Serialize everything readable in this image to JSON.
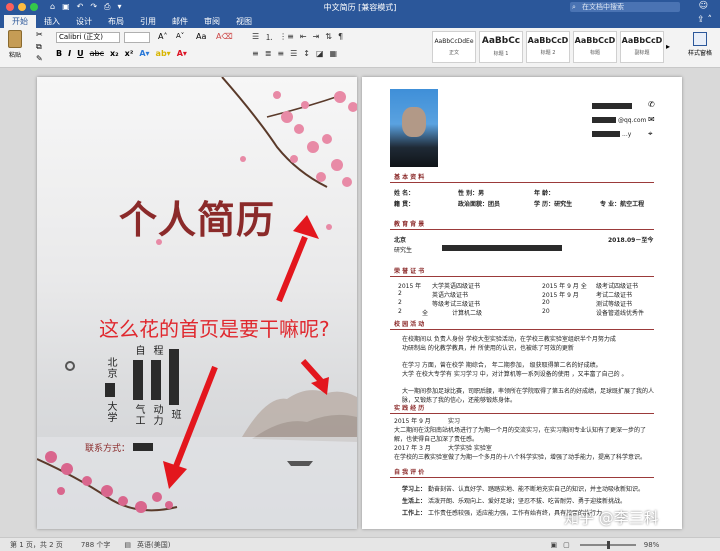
{
  "titlebar": {
    "title": "中文简历 [兼容模式]",
    "search_placeholder": "在文档中搜索"
  },
  "tabs": [
    {
      "label": "开始"
    },
    {
      "label": "插入"
    },
    {
      "label": "设计"
    },
    {
      "label": "布局"
    },
    {
      "label": "引用"
    },
    {
      "label": "邮件"
    },
    {
      "label": "审阅"
    },
    {
      "label": "视图"
    }
  ],
  "ribbon": {
    "paste_label": "粘贴",
    "font_name": "Calibri (正文)",
    "font_size": "",
    "format_buttons": [
      "B",
      "I",
      "U",
      "abc",
      "x₂",
      "x²"
    ],
    "styles": [
      {
        "sample": "AaBbCcDdEe",
        "name": "正文"
      },
      {
        "sample": "AaBbCc",
        "name": "标题 1"
      },
      {
        "sample": "AaBbCcD",
        "name": "标题 2"
      },
      {
        "sample": "AaBbCcD",
        "name": "标题"
      },
      {
        "sample": "AaBbCcD",
        "name": "副标题"
      }
    ],
    "style_pane_label": "样式窗格"
  },
  "cover": {
    "title": "个人简历",
    "question": "这么花的首页是要干嘛呢?",
    "columns": [
      "北京",
      "大学",
      "自",
      "气工",
      "程",
      "动力",
      "班"
    ],
    "contact_label": "联系方式："
  },
  "resume": {
    "email_suffix": "@qq.com",
    "wechat_suffix": "...y",
    "sections": {
      "basic": "基 本 资 料",
      "education": "教 育 背 景",
      "certificates": "荣 誉 证 书",
      "activities": "校 园 活 动",
      "practice": "实 践 经 历",
      "evaluation": "自 我 评 价"
    },
    "basic_rows": [
      [
        "姓    名：",
        "性    别：男",
        "年    龄："
      ],
      [
        "籍    贯：",
        "政治面貌：团员",
        "学    历：研究生",
        "专    业：航空工程"
      ]
    ],
    "education": [
      {
        "school": "北京",
        "period": "2018.09－至今"
      },
      {
        "school": "研究生",
        "period": ""
      }
    ],
    "certificates": [
      [
        "2015 年",
        "大学英语四级证书",
        "2015 年 9 月 全",
        "级考试四级证书"
      ],
      [
        "2",
        "英语六级证书",
        "2015 年 9 月",
        "考试二级证书"
      ],
      [
        "2",
        "等级考试三级证书",
        "20",
        "测试等级证书"
      ],
      [
        "2",
        "全",
        "计算机二级",
        "20",
        "设备管道线优秀件"
      ]
    ],
    "activities": [
      "在校期间以 负责人身份 学校大型实验活动，在学校三教实验室组织半个月努力成",
      "功研制出 的化教学教具，并 所使用的认识，也被练了可效的更新",
      "在学习 方面，曾在校学 期综合， 年二期参加， 级获取得第二名的好成绩。",
      "大学 在校大专学有 实习学习 中，对计算机等一系列设备的使用 ，又丰富了自己的 。",
      "大一期间参加足球比赛，司职后腰，率领所在学院取得了第五名的好成绩，足球既扩展了我的人脉，又锻炼了我的信心，还能够锻炼身体。"
    ],
    "practice": [
      {
        "date": "2015 年 9 月",
        "title": "实习"
      },
      {
        "text": "大二期间在沈阳南站机场进行了为期一个月的交流实习，在实习期间专业认知有了更深一步的了解，也使得自己加深了责任感。"
      },
      {
        "date": "2017 年 3 月",
        "title": "大学实验 实验室"
      },
      {
        "text": "在学校的三教实验室做了为期一个多月的十八个科学实验，增强了动手能力，提高了科学意识。"
      }
    ],
    "evaluation": [
      {
        "label": "学习上：",
        "text": "勤奋刻苦、认真好学、踏踏实地、能不断地充实自己的知识，并主动吸收新知识。"
      },
      {
        "label": "生活上：",
        "text": "活泼开朗、乐观向上、爱好足球；坚忍不拔、吃苦耐劳、勇于迎接新挑战。"
      },
      {
        "label": "工作上：",
        "text": "工作责任感较强，适应能力强，工作有始有终，具有较强的执行力"
      }
    ]
  },
  "statusbar": {
    "page": "第 1 页，共 2 页",
    "words": "788 个字",
    "lang": "英语(美国)",
    "zoom": "98%"
  },
  "watermark": "知乎 @李三科"
}
